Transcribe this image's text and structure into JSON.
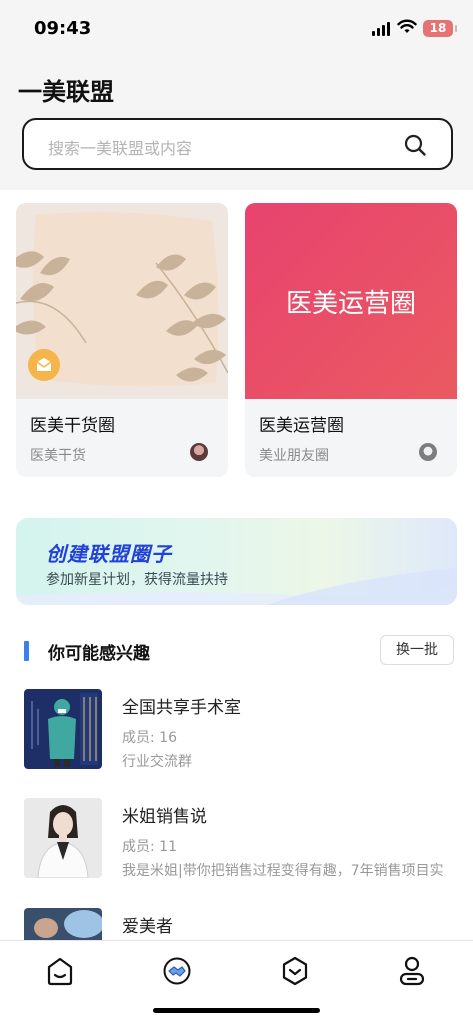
{
  "status_bar": {
    "time": "09:43",
    "battery": "18"
  },
  "header": {
    "title": "一美联盟"
  },
  "search": {
    "placeholder": "搜索一美联盟或内容"
  },
  "circles": [
    {
      "name": "医美干货圈",
      "sub": "医美干货"
    },
    {
      "name": "医美运营圈",
      "sub": "美业朋友圈",
      "cover_text": "医美运营圈"
    }
  ],
  "banner": {
    "title": "创建联盟圈子",
    "subtitle": "参加新星计划，获得流量扶持"
  },
  "recommend": {
    "title": "你可能感兴趣",
    "refresh_label": "换一批",
    "items": [
      {
        "name": "全国共享手术室",
        "members": "成员: 16",
        "desc": "行业交流群"
      },
      {
        "name": "米姐销售说",
        "members": "成员: 11",
        "desc": "我是米姐|带你把销售过程变得有趣，7年销售项目实"
      },
      {
        "name": "爱美者",
        "members": "",
        "desc": ""
      }
    ]
  },
  "tabs": [
    {
      "icon": "home-icon"
    },
    {
      "icon": "alliance-handshake-icon"
    },
    {
      "icon": "hexagon-icon"
    },
    {
      "icon": "profile-icon"
    }
  ],
  "colors": {
    "accent": "#3a7ff0",
    "banner_title": "#2341d6",
    "card_red": "#e8436e",
    "badge": "#f5b54a"
  }
}
